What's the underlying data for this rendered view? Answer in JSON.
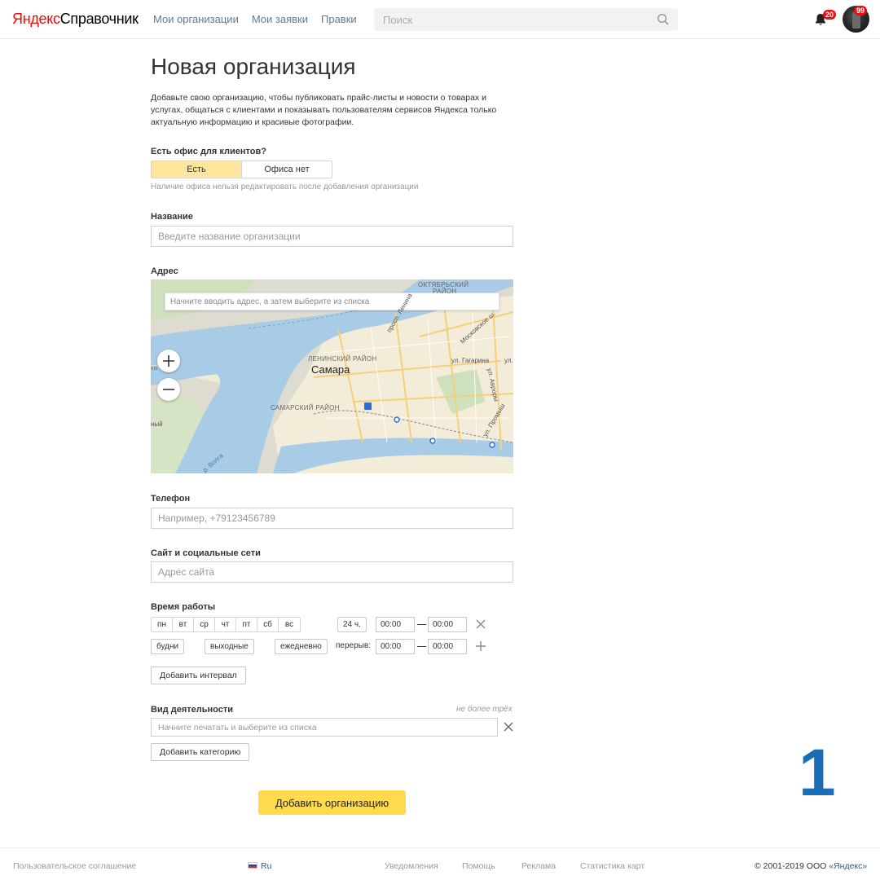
{
  "header": {
    "logo_brand": "Яндекс",
    "logo_product": "Справочник",
    "nav": [
      "Мои организации",
      "Мои заявки",
      "Правки"
    ],
    "search_placeholder": "Поиск",
    "notifications_count": "20",
    "avatar_badge": "99"
  },
  "main": {
    "title": "Новая организация",
    "intro": "Добавьте свою организацию, чтобы публиковать прайс-листы и новости о товарах и услугах, общаться с клиентами и показывать пользователям сервисов Яндекса только актуальную информацию и красивые фотографии.",
    "office": {
      "label": "Есть офис для клиентов?",
      "options": [
        "Есть",
        "Офиса нет"
      ],
      "selected": "Есть",
      "hint": "Наличие офиса нельзя редактировать после добавления организации"
    },
    "name": {
      "label": "Название",
      "placeholder": "Введите название организации"
    },
    "address": {
      "label": "Адрес",
      "search_placeholder": "Начните вводить адрес, а затем выберите из списка",
      "map_labels": {
        "city": "Самара",
        "district1": "ЛЕНИНСКИЙ РАЙОН",
        "district2": "САМАРСКИЙ РАЙОН",
        "district3_line1": "ОКТЯБРЬСКИЙ",
        "district3_line2": "РАЙОН",
        "street1": "ул. Гагарина",
        "street2": "ул.",
        "street3": "просп. Ленина",
        "street4": "Московское ш.",
        "street5": "ул. Авроры",
        "street6": "ул. Промыш",
        "river": "р. Волга",
        "edge1": "ка",
        "edge2": "ный"
      }
    },
    "phone": {
      "label": "Телефон",
      "placeholder": "Например, +79123456789"
    },
    "site": {
      "label": "Сайт и социальные сети",
      "placeholder": "Адрес сайта"
    },
    "hours": {
      "label": "Время работы",
      "days": [
        "пн",
        "вт",
        "ср",
        "чт",
        "пт",
        "сб",
        "вс"
      ],
      "around_the_clock": "24 ч.",
      "from": "00:00",
      "to": "00:00",
      "presets": [
        "будни",
        "выходные",
        "ежедневно"
      ],
      "break_label": "перерыв:",
      "break_from": "00:00",
      "break_to": "00:00",
      "add_interval": "Добавить интервал"
    },
    "activity": {
      "label": "Вид деятельности",
      "limit_hint": "не более трёх",
      "placeholder": "Начните печатать и выберите из списка",
      "add_category": "Добавить категорию"
    },
    "submit": "Добавить организацию",
    "step_number": "1"
  },
  "footer": {
    "agreement": "Пользовательское соглашение",
    "lang": "Ru",
    "links": [
      "Уведомления",
      "Помощь",
      "Реклама",
      "Статистика карт"
    ],
    "copyright_prefix": "© 2001-2019  ООО ",
    "copyright_link": "«Яндекс»"
  },
  "colors": {
    "accent_yellow": "#ffdb4d",
    "selected_segment": "#ffe69f",
    "nav_link": "#5e7b94",
    "badge_red": "#e81010",
    "step_number_blue": "#1a6eb5"
  }
}
